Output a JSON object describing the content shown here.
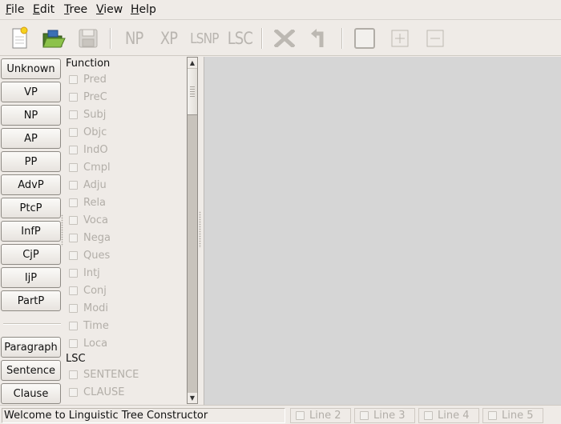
{
  "menubar": {
    "items": [
      {
        "pre": "",
        "mnemonic": "F",
        "post": "ile"
      },
      {
        "pre": "",
        "mnemonic": "E",
        "post": "dit"
      },
      {
        "pre": "",
        "mnemonic": "T",
        "post": "ree"
      },
      {
        "pre": "",
        "mnemonic": "V",
        "post": "iew"
      },
      {
        "pre": "",
        "mnemonic": "H",
        "post": "elp"
      }
    ]
  },
  "toolbar": {
    "np_label": "NP",
    "xp_label": "XP",
    "lsnp_label": "LSNP",
    "lsc_label": "LSC",
    "icons": [
      "new-document-icon",
      "open-folder-icon",
      "save-icon",
      "delete-icon",
      "undo-icon",
      "box-icon",
      "plus-icon",
      "minus-icon"
    ]
  },
  "phrase_buttons": [
    "Unknown",
    "VP",
    "NP",
    "AP",
    "PP",
    "AdvP",
    "PtcP",
    "InfP",
    "CjP",
    "IjP",
    "PartP"
  ],
  "bottom_buttons": [
    "Paragraph",
    "Sentence",
    "Clause"
  ],
  "function_section": {
    "title": "Function",
    "items": [
      "Pred",
      "PreC",
      "Subj",
      "Objc",
      "IndO",
      "Cmpl",
      "Adju",
      "Rela",
      "Voca",
      "Nega",
      "Ques",
      "Intj",
      "Conj",
      "Modi",
      "Time",
      "Loca"
    ]
  },
  "lsc_section": {
    "title": "LSC",
    "items": [
      "SENTENCE",
      "CLAUSE"
    ]
  },
  "statusbar": {
    "message": "Welcome to Linguistic Tree Constructor",
    "lines": [
      "Line 2",
      "Line 3",
      "Line 4",
      "Line 5"
    ]
  },
  "colors": {
    "window_bg": "#efebe7",
    "canvas_bg": "#d6d6d6",
    "disabled_text": "#b2aea8"
  }
}
